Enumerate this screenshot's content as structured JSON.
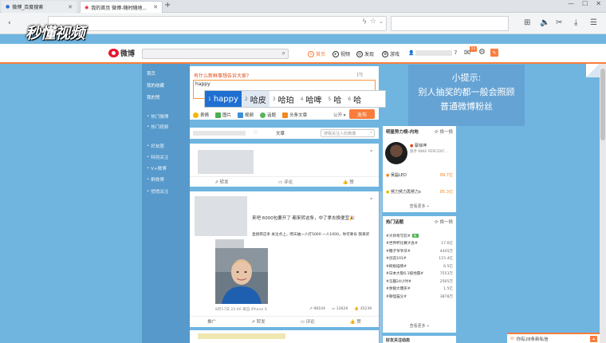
{
  "browser": {
    "tabs": [
      {
        "title": "微博_百度搜索"
      },
      {
        "title": "我的首页 微博-随时随地..."
      }
    ],
    "new_tab": "+",
    "window_controls": [
      "—",
      "☐",
      "✕"
    ]
  },
  "watermark": "秒懂视频",
  "weibo": {
    "logo": "微博",
    "nav": [
      {
        "label": "首页"
      },
      {
        "label": "视频"
      },
      {
        "label": "发现"
      },
      {
        "label": "游戏"
      }
    ],
    "user_suffix": "7",
    "notify_count": "11"
  },
  "left_nav": {
    "top": [
      "首页",
      "我的收藏",
      "我的赞"
    ],
    "groups": [
      "热门微博",
      "热门视频",
      "好友圈",
      "特别关注",
      "V+微博",
      "群微博",
      "悄悄关注"
    ]
  },
  "composer": {
    "hint": "有什么新鲜事想告诉大家?",
    "text": "happy",
    "ime_candidates": [
      {
        "n": "1",
        "text": "happy"
      },
      {
        "n": "2",
        "text": "哈皮"
      },
      {
        "n": "3",
        "text": "哈珀"
      },
      {
        "n": "4",
        "text": "哈啤"
      },
      {
        "n": "5",
        "text": "哈"
      },
      {
        "n": "6",
        "text": "哈"
      }
    ],
    "tools": [
      "表情",
      "图片",
      "视频",
      "话题",
      "头条文章"
    ],
    "visibility": "公开",
    "publish": "发布"
  },
  "feed_tabs": {
    "items": [
      "文章"
    ],
    "search_placeholder": "搜我关注人的微博"
  },
  "feed": {
    "card1": {
      "actions": [
        "转发",
        "评论",
        "赞"
      ]
    },
    "card2": {
      "line1": "来吧 6000包要开了 都来转这条，中了拿去换便宜🎉",
      "line2": "直接转这条 关注点上，明天抽一人打5000 一人1000，你可要肯 我来买",
      "meta": "8月17日 22:40 来自 iPhone X",
      "stats": [
        "98104",
        "13626",
        "35239"
      ],
      "actions": [
        "推广",
        "转发",
        "评论",
        "赞"
      ]
    }
  },
  "right": {
    "star_panel": {
      "title": "明星势力榜-内地",
      "switch": "换一换",
      "top_name": "蔡徐坤",
      "top_sub": "歌手 NINE PERCENT...",
      "items": [
        {
          "name": "吴磊LEO",
          "score": "89.7亿"
        },
        {
          "name": "努力努力再努力x",
          "score": "85.3亿"
        }
      ],
      "more": "查看更多 »"
    },
    "hot_panel": {
      "title": "热门话题",
      "switch": "换一换",
      "items": [
        {
          "topic": "#大师哥写怼#",
          "count": "",
          "hot": "热"
        },
        {
          "topic": "#世界杯比赛大会#",
          "count": "17.6亿"
        },
        {
          "topic": "#鞭子爷爷牙#",
          "count": "4445万"
        },
        {
          "topic": "#创造101#",
          "count": "115.4亿"
        },
        {
          "topic": "#刷板描情#",
          "count": "6.5亿"
        },
        {
          "topic": "#日本大阪6.1级地震#",
          "count": "7553万"
        },
        {
          "topic": "#怎趣24小时#",
          "count": "2565万"
        },
        {
          "topic": "#余额大爆买#",
          "count": "1.5亿"
        },
        {
          "topic": "#聊怪猫父#",
          "count": "3878万"
        }
      ],
      "more": "查看更多 »"
    },
    "bottom_label": "好友关注动态"
  },
  "tip": {
    "lines": [
      "小提示:",
      "别人抽奖的都一般会照顾",
      "普通微博粉丝"
    ]
  },
  "chat": {
    "text": "你有28条新私信"
  },
  "colors": {
    "accent": "#fa7d3c",
    "bg": "#6fb5e0",
    "ime_selected": "#1e6fd1"
  }
}
